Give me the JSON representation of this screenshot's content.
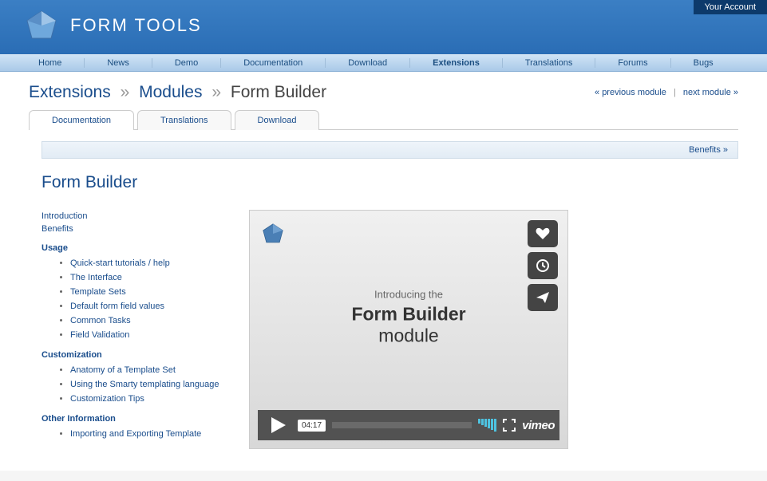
{
  "account_link": "Your Account",
  "brand": "FORM TOOLS",
  "mainnav": [
    {
      "label": "Home",
      "active": false
    },
    {
      "label": "News",
      "active": false
    },
    {
      "label": "Demo",
      "active": false
    },
    {
      "label": "Documentation",
      "active": false
    },
    {
      "label": "Download",
      "active": false
    },
    {
      "label": "Extensions",
      "active": true
    },
    {
      "label": "Translations",
      "active": false
    },
    {
      "label": "Forums",
      "active": false
    },
    {
      "label": "Bugs",
      "active": false
    }
  ],
  "breadcrumb": {
    "parts": [
      "Extensions",
      "Modules",
      "Form Builder"
    ]
  },
  "module_nav": {
    "prev": "« previous module",
    "next": "next module »"
  },
  "tabs": [
    {
      "label": "Documentation",
      "active": true
    },
    {
      "label": "Translations",
      "active": false
    },
    {
      "label": "Download",
      "active": false
    }
  ],
  "benefits_bar": "Benefits »",
  "page_title": "Form Builder",
  "sidebar": {
    "top_links": [
      "Introduction",
      "Benefits"
    ],
    "sections": [
      {
        "title": "Usage",
        "items": [
          "Quick-start tutorials / help",
          "The Interface",
          "Template Sets",
          "Default form field values",
          "Common Tasks",
          "Field Validation"
        ]
      },
      {
        "title": "Customization",
        "items": [
          "Anatomy of a Template Set",
          "Using the Smarty templating language",
          "Customization Tips"
        ]
      },
      {
        "title": "Other Information",
        "items": [
          "Importing and Exporting Template"
        ]
      }
    ]
  },
  "video": {
    "intro_line": "Introducing the",
    "title_bold": "Form Builder",
    "title_rest": " module",
    "duration": "04:17",
    "provider": "vimeo"
  }
}
